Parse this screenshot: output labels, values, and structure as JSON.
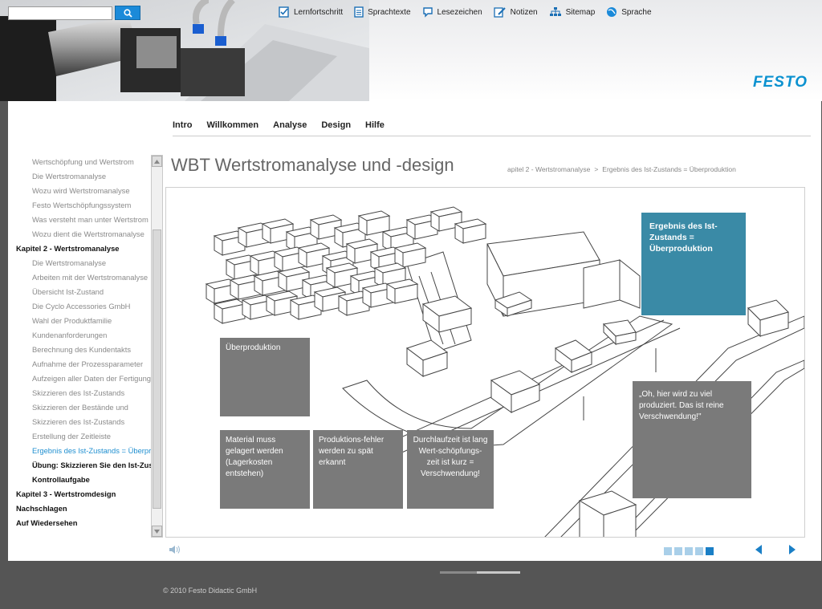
{
  "header": {
    "search_placeholder": "",
    "brand": "FESTO",
    "top_nav": [
      {
        "label": "Lernfortschritt",
        "icon": "checklist-icon"
      },
      {
        "label": "Sprachtexte",
        "icon": "document-icon"
      },
      {
        "label": "Lesezeichen",
        "icon": "bookmark-icon"
      },
      {
        "label": "Notizen",
        "icon": "pencil-icon"
      },
      {
        "label": "Sitemap",
        "icon": "sitemap-icon"
      },
      {
        "label": "Sprache",
        "icon": "globe-icon"
      }
    ]
  },
  "main_tabs": [
    "Intro",
    "Willkommen",
    "Analyse",
    "Design",
    "Hilfe"
  ],
  "sidebar": {
    "items": [
      {
        "label": "Wertschöpfung und Wertstrom",
        "level": "sub"
      },
      {
        "label": "Die Wertstromanalyse",
        "level": "sub"
      },
      {
        "label": "Wozu wird Wertstromanalyse",
        "level": "sub"
      },
      {
        "label": "Festo Wertschöpfungssystem",
        "level": "sub"
      },
      {
        "label": "Was versteht man unter Wertstrom",
        "level": "sub"
      },
      {
        "label": "Wozu dient die Wertstromanalyse",
        "level": "sub"
      },
      {
        "label": "Kapitel 2 - Wertstromanalyse",
        "level": "main"
      },
      {
        "label": "Die Wertstromanalyse",
        "level": "sub"
      },
      {
        "label": "Arbeiten mit der Wertstromanalyse",
        "level": "sub"
      },
      {
        "label": "Übersicht Ist-Zustand",
        "level": "sub"
      },
      {
        "label": "Die Cyclo Accessories GmbH",
        "level": "sub"
      },
      {
        "label": "Wahl der Produktfamilie",
        "level": "sub"
      },
      {
        "label": "Kundenanforderungen",
        "level": "sub"
      },
      {
        "label": "Berechnung des Kundentakts",
        "level": "sub"
      },
      {
        "label": "Aufnahme der Prozessparameter",
        "level": "sub"
      },
      {
        "label": "Aufzeigen aller Daten der Fertigung",
        "level": "sub"
      },
      {
        "label": "Skizzieren des Ist-Zustands",
        "level": "sub"
      },
      {
        "label": "Skizzieren der Bestände und",
        "level": "sub"
      },
      {
        "label": "Skizzieren des Ist-Zustands",
        "level": "sub"
      },
      {
        "label": "Erstellung der Zeitleiste",
        "level": "sub"
      },
      {
        "label": "Ergebnis des Ist-Zustands = Überproduktion",
        "level": "active"
      },
      {
        "label": "Übung: Skizzieren Sie den Ist-Zustand",
        "level": "current"
      },
      {
        "label": "Kontrollaufgabe",
        "level": "current"
      },
      {
        "label": "Kapitel 3 - Wertstromdesign",
        "level": "main"
      },
      {
        "label": "Nachschlagen",
        "level": "main"
      },
      {
        "label": "Auf Wiedersehen",
        "level": "main"
      }
    ]
  },
  "page": {
    "title": "WBT Wertstromanalyse und -design",
    "breadcrumb": [
      "apitel 2 - Wertstromanalyse",
      ">",
      "Ergebnis des Ist-Zustands = Überproduktion"
    ]
  },
  "figure": {
    "callout_title": "Ergebnis des Ist-Zustands = Überproduktion",
    "box_overproduction": "Überproduktion",
    "box_material": "Material muss gelagert werden (Lagerkosten entstehen)",
    "box_errors": "Produktions-fehler werden zu spät erkannt",
    "box_leadtime": "Durchlaufzeit ist lang Wert-schöpfungs-zeit ist kurz = Verschwendung!",
    "box_quote": "„Oh, hier wird zu viel produziert. Das ist reine Verschwendung!\""
  },
  "pager": {
    "pages": 5,
    "current": 5
  },
  "footer": {
    "copyright": "© 2010 Festo Didactic GmbH"
  },
  "colors": {
    "accent": "#1b8ad9",
    "brand": "#0a91d0",
    "callout_teal": "#3a8aa6",
    "box_grey": "#7a7a7a"
  }
}
